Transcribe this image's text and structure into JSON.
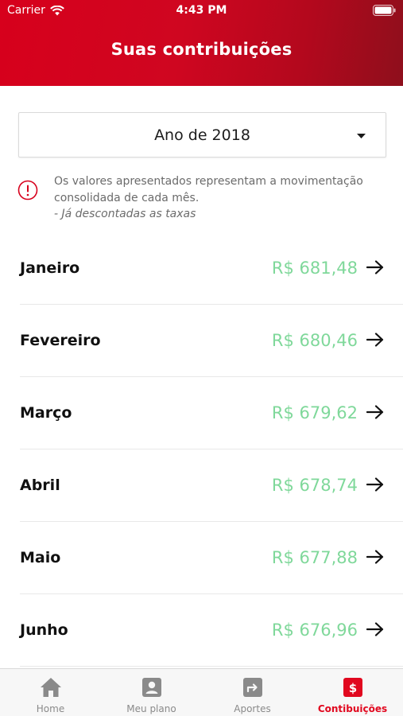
{
  "status_bar": {
    "carrier": "Carrier",
    "time": "4:43 PM"
  },
  "header": {
    "title": "Suas contribuições"
  },
  "year_select": {
    "value": "Ano de 2018"
  },
  "info": {
    "text": "Os valores apresentados representam a movimentação consolidada de cada mês.",
    "note": "- Já descontadas as taxas"
  },
  "months": [
    {
      "name": "Janeiro",
      "value": "R$ 681,48"
    },
    {
      "name": "Fevereiro",
      "value": "R$ 680,46"
    },
    {
      "name": "Março",
      "value": "R$ 679,62"
    },
    {
      "name": "Abril",
      "value": "R$ 678,74"
    },
    {
      "name": "Maio",
      "value": "R$ 677,88"
    },
    {
      "name": "Junho",
      "value": "R$ 676,96"
    }
  ],
  "tabbar": {
    "items": [
      {
        "label": "Home",
        "icon": "home-icon"
      },
      {
        "label": "Meu plano",
        "icon": "profile-icon"
      },
      {
        "label": "Aportes",
        "icon": "transfer-icon"
      },
      {
        "label": "Contibuições",
        "icon": "dollar-icon"
      }
    ],
    "active_index": 3
  },
  "colors": {
    "brand_red": "#d7001c",
    "value_green": "#7fd89a",
    "tab_inactive": "#8a8a8a"
  }
}
